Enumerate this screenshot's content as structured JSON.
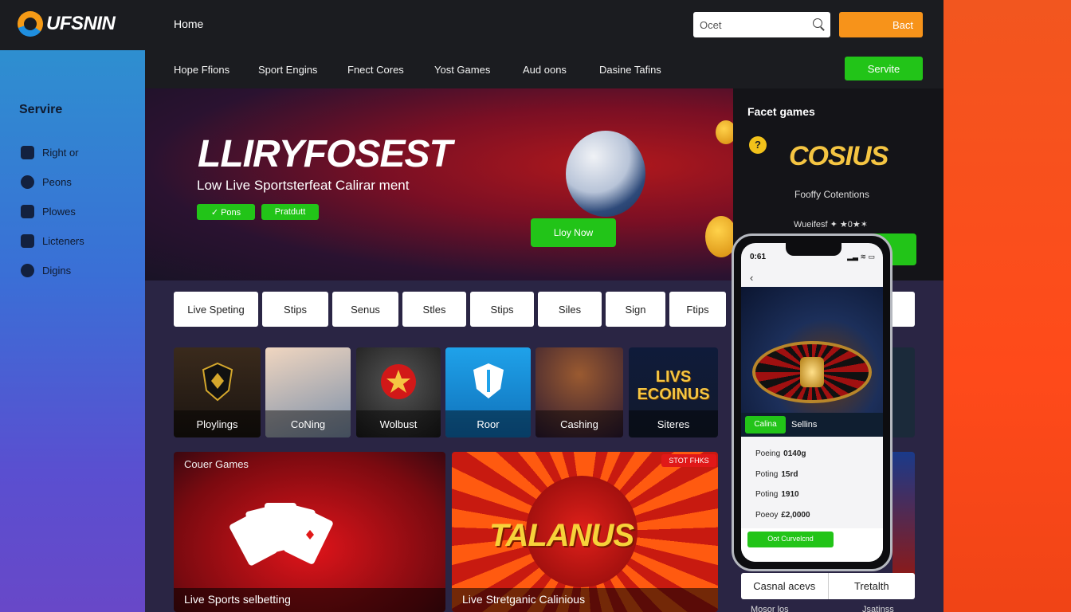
{
  "app": {
    "logo_text": "UFSNIN"
  },
  "topbar": {
    "home": "Home",
    "search_placeholder": "Ocet",
    "cta": "Bact"
  },
  "nav": {
    "items": [
      "Hope Ffions",
      "Sport Engins",
      "Fnect Cores",
      "Yost Games",
      "Aud oons",
      "Dasine Tafins"
    ],
    "cta": "Servite"
  },
  "sidebar": {
    "title": "Servire",
    "items": [
      {
        "label": "Right or",
        "icon": "home-icon"
      },
      {
        "label": "Peons",
        "icon": "question-icon"
      },
      {
        "label": "Plowes",
        "icon": "mail-icon"
      },
      {
        "label": "Licteners",
        "icon": "facebook-icon"
      },
      {
        "label": "Digins",
        "icon": "location-icon"
      }
    ]
  },
  "hero": {
    "title": "LLIRYFOSEST",
    "subtitle": "Low  Live Sportsterfeat Calirar ment",
    "pill1": "✓ Pons",
    "pill2": "Pratdutt",
    "cta": "Lloy Now"
  },
  "featured": {
    "title": "Facet games",
    "badge": "?",
    "logo": "COSIUS",
    "subtitle": "Fooffy Cotentions",
    "rating": "Wueifesf ✦ ★0★✶"
  },
  "chips": [
    "Live Speting",
    "Stips",
    "Senus",
    "Stles",
    "Stips",
    "Siles",
    "Sign",
    "Ftips"
  ],
  "tiles": [
    {
      "label": "Ploylings"
    },
    {
      "label": "CoNing"
    },
    {
      "label": "Wolbust"
    },
    {
      "label": "Roor"
    },
    {
      "label": "Cashing"
    },
    {
      "label": "Siteres"
    }
  ],
  "cards": [
    {
      "top": "Couer Games",
      "bottom": "Live Sports selbetting"
    },
    {
      "badge": "STOT FHKS",
      "logo": "TALANUS",
      "bottom": "Live Stretganic Calinious"
    }
  ],
  "tile_logo": "LIVS ECOINUS",
  "right_col": {
    "bottom_tabs": [
      "Casnal acevs",
      "Tretalth"
    ],
    "foot_left": "Mosor los",
    "foot_right": "Jsatinss"
  },
  "phone": {
    "time": "0:61",
    "status": "▂▃ ≋ ▭",
    "tabs": {
      "active": "Calina",
      "other": "Sellins"
    },
    "rows": [
      {
        "k": "Poeing",
        "v": "0140g"
      },
      {
        "k": "Poting",
        "v": "15rd"
      },
      {
        "k": "Poting",
        "v": "1910"
      },
      {
        "k": "Poeoy",
        "v": "£2,0000"
      }
    ],
    "cta": "Oot Curvelcnd"
  },
  "colors": {
    "accent_green": "#22c418",
    "accent_orange": "#f7931a",
    "strip_orange": "#ff4a1a"
  }
}
